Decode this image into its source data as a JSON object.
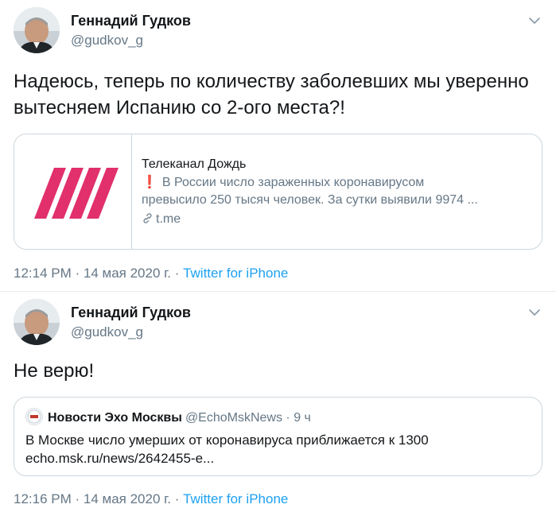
{
  "tweets": [
    {
      "author": {
        "name": "Геннадий Гудков",
        "handle": "@gudkov_g"
      },
      "text": "Надеюсь, теперь по количеству заболевших мы уверенно вытесняем Испанию со 2-ого места?!",
      "card": {
        "title": "Телеканал Дождь",
        "excl": "❗",
        "desc_line1": "В России число зараженных коронавирусом",
        "desc_line2": "превысило 250 тысяч человек. За сутки выявили 9974 ...",
        "domain": "t.me"
      },
      "time": "12:14 PM · 14 мая 2020 г. · ",
      "source": "Twitter for iPhone"
    },
    {
      "author": {
        "name": "Геннадий Гудков",
        "handle": "@gudkov_g"
      },
      "text": "Не верю!",
      "quote": {
        "name": "Новости Эхо Москвы",
        "handle": "@EchoMskNews · 9 ч",
        "text": "В Москве число умерших от коронавируса приближается к 1300 echo.msk.ru/news/2642455-e..."
      },
      "time": "12:16 PM · 14 мая 2020 г. · ",
      "source": "Twitter for iPhone"
    }
  ],
  "icons": {
    "chevron": "chevron-down-icon",
    "link": "link-icon"
  },
  "colors": {
    "accent": "#1da1f2",
    "muted": "#657786",
    "text": "#14171a",
    "dozhd_brand": "#e1306c",
    "alert": "#e0245e"
  }
}
